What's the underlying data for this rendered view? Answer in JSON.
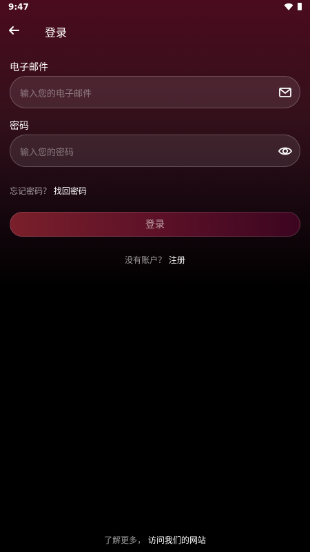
{
  "status": {
    "time": "9:47"
  },
  "appbar": {
    "title": "登录"
  },
  "form": {
    "email": {
      "label": "电子邮件",
      "placeholder": "输入您的电子邮件"
    },
    "password": {
      "label": "密码",
      "placeholder": "输入您的密码"
    }
  },
  "forgot": {
    "prompt": "忘记密码？",
    "link": "找回密码"
  },
  "login_button": "登录",
  "register": {
    "prompt": "没有账户？",
    "link": "注册"
  },
  "footer": {
    "prompt": "了解更多，",
    "link": "访问我们的网站"
  },
  "colors": {
    "background": "#000000",
    "gradient_top": "#4a0b1e",
    "button_start": "#7a1f2b",
    "button_end": "#3c0520"
  },
  "icons": {
    "back": "arrow-left",
    "email_field": "mail",
    "password_field": "eye"
  }
}
